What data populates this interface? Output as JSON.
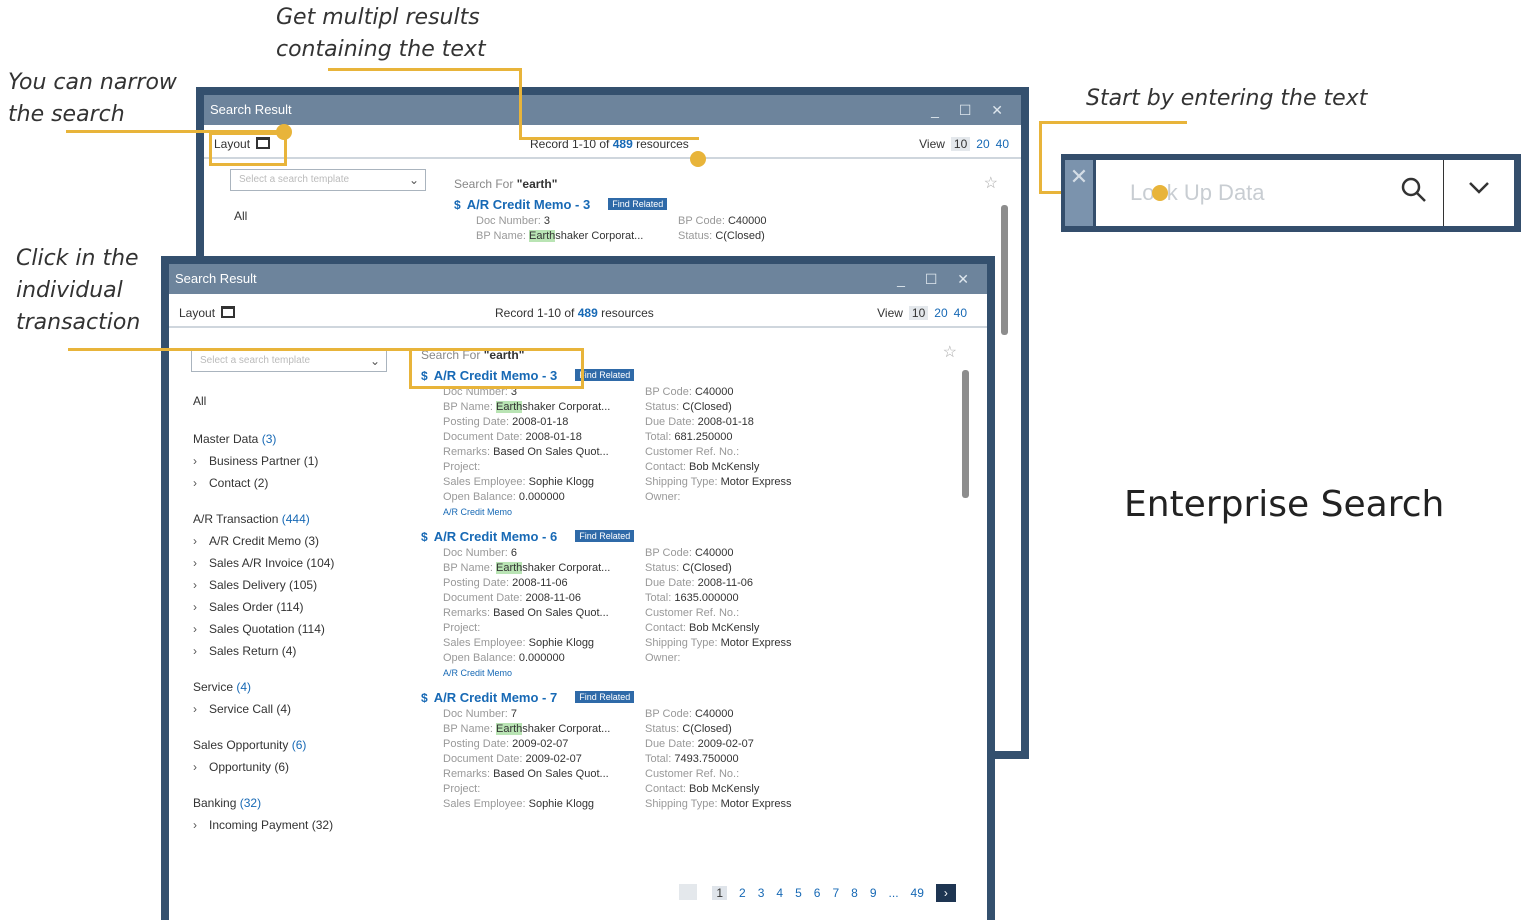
{
  "annotations": {
    "multiple_results": "Get multipl results\ncontaining the text",
    "narrow": "You can narrow\nthe search",
    "start": "Start by entering the text",
    "click": "Click in the\nindividual\ntransaction"
  },
  "lookup": {
    "placeholder": "Look Up Data",
    "close_icon": "close-icon",
    "search_icon": "search-icon",
    "dropdown_icon": "chevron-down-icon"
  },
  "enterprise_label": "Enterprise Search",
  "colors": {
    "accent": "#e8b43a",
    "window_border": "#34506e",
    "title_bar": "#6d849c",
    "link": "#1769b5"
  },
  "back_window": {
    "title": "Search Result",
    "layout_label": "Layout",
    "record_prefix": "Record 1-10 of",
    "record_count": "489",
    "record_suffix": "resources",
    "view_label": "View",
    "view_options": [
      "10",
      "20",
      "40"
    ],
    "template_placeholder": "Select a search template",
    "all_label": "All",
    "search_for_label": "Search For",
    "search_for_value": "\"earth\"",
    "result": {
      "title": "A/R Credit Memo - 3",
      "find_related": "Find Related",
      "doc_number_key": "Doc Number:",
      "doc_number": "3",
      "bp_code_key": "BP Code:",
      "bp_code": "C40000",
      "bp_name_key": "BP Name:",
      "bp_name_hl": "Earth",
      "bp_name_rest": "shaker Corporat...",
      "status_key": "Status:",
      "status": "C(Closed)"
    }
  },
  "front_window": {
    "title": "Search Result",
    "layout_label": "Layout",
    "record_prefix": "Record 1-10 of",
    "record_count": "489",
    "record_suffix": "resources",
    "view_label": "View",
    "view_options": [
      "10",
      "20",
      "40"
    ],
    "template_placeholder": "Select a search template",
    "all_label": "All",
    "search_for_label": "Search For",
    "search_for_value": "\"earth\"",
    "groups": [
      {
        "name": "Master Data",
        "count": "(3)",
        "items": [
          {
            "label": "Business Partner",
            "count": "(1)"
          },
          {
            "label": "Contact",
            "count": "(2)"
          }
        ]
      },
      {
        "name": "A/R Transaction",
        "count": "(444)",
        "items": [
          {
            "label": "A/R Credit Memo",
            "count": "(3)"
          },
          {
            "label": "Sales A/R Invoice",
            "count": "(104)"
          },
          {
            "label": "Sales Delivery",
            "count": "(105)"
          },
          {
            "label": "Sales Order",
            "count": "(114)"
          },
          {
            "label": "Sales Quotation",
            "count": "(114)"
          },
          {
            "label": "Sales Return",
            "count": "(4)"
          }
        ]
      },
      {
        "name": "Service",
        "count": "(4)",
        "items": [
          {
            "label": "Service Call",
            "count": "(4)"
          }
        ]
      },
      {
        "name": "Sales Opportunity",
        "count": "(6)",
        "items": [
          {
            "label": "Opportunity",
            "count": "(6)"
          }
        ]
      },
      {
        "name": "Banking",
        "count": "(32)",
        "items": [
          {
            "label": "Incoming Payment",
            "count": "(32)"
          }
        ]
      }
    ],
    "results": [
      {
        "title": "A/R Credit Memo - 3",
        "find_related": "Find Related",
        "doc_number": "3",
        "bp_code": "C40000",
        "bp_name_hl": "Earth",
        "bp_name_rest": "shaker Corporat...",
        "status": "C(Closed)",
        "posting_date": "2008-01-18",
        "due_date": "2008-01-18",
        "document_date": "2008-01-18",
        "total": "681.250000",
        "remarks": "Based On Sales Quot...",
        "customer_ref": "",
        "project": "",
        "contact": "Bob McKensly",
        "sales_employee": "Sophie Klogg",
        "shipping_type": "Motor Express",
        "open_balance": "0.000000",
        "owner": "",
        "link": "A/R Credit Memo"
      },
      {
        "title": "A/R Credit Memo - 6",
        "find_related": "Find Related",
        "doc_number": "6",
        "bp_code": "C40000",
        "bp_name_hl": "Earth",
        "bp_name_rest": "shaker Corporat...",
        "status": "C(Closed)",
        "posting_date": "2008-11-06",
        "due_date": "2008-11-06",
        "document_date": "2008-11-06",
        "total": "1635.000000",
        "remarks": "Based On Sales Quot...",
        "customer_ref": "",
        "project": "",
        "contact": "Bob McKensly",
        "sales_employee": "Sophie Klogg",
        "shipping_type": "Motor Express",
        "open_balance": "0.000000",
        "owner": "",
        "link": "A/R Credit Memo"
      },
      {
        "title": "A/R Credit Memo - 7",
        "find_related": "Find Related",
        "doc_number": "7",
        "bp_code": "C40000",
        "bp_name_hl": "Earth",
        "bp_name_rest": "shaker Corporat...",
        "status": "C(Closed)",
        "posting_date": "2009-02-07",
        "due_date": "2009-02-07",
        "document_date": "2009-02-07",
        "total": "7493.750000",
        "remarks": "Based On Sales Quot...",
        "customer_ref": "",
        "project": "",
        "contact": "Bob McKensly",
        "sales_employee": "Sophie Klogg",
        "shipping_type": "Motor Express"
      }
    ],
    "labels": {
      "doc_number": "Doc Number:",
      "bp_code": "BP Code:",
      "bp_name": "BP Name:",
      "status": "Status:",
      "posting_date": "Posting Date:",
      "due_date": "Due Date:",
      "document_date": "Document Date:",
      "total": "Total:",
      "remarks": "Remarks:",
      "customer_ref": "Customer Ref. No.:",
      "project": "Project:",
      "contact": "Contact:",
      "sales_employee": "Sales Employee:",
      "shipping_type": "Shipping Type:",
      "open_balance": "Open Balance:",
      "owner": "Owner:"
    },
    "pager": {
      "pages": [
        "1",
        "2",
        "3",
        "4",
        "5",
        "6",
        "7",
        "8",
        "9",
        "...",
        "49"
      ],
      "current": "1"
    }
  }
}
